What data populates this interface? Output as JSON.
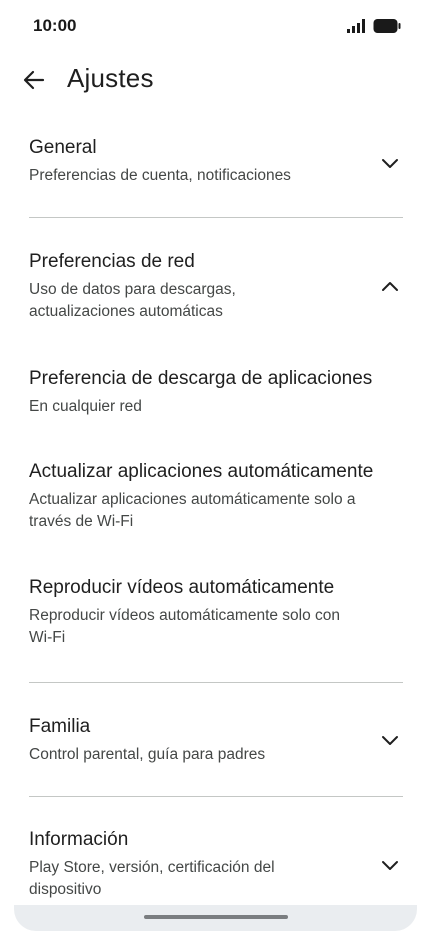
{
  "status": {
    "time": "10:00",
    "icons": [
      "signal-icon",
      "battery-icon"
    ]
  },
  "header": {
    "back_icon": "arrow-left-icon",
    "title": "Ajustes"
  },
  "sections": {
    "general": {
      "title": "General",
      "subtitle": "Preferencias de cuenta, notificaciones",
      "state": "collapsed"
    },
    "network": {
      "title": "Preferencias de red",
      "subtitle_line1": "Uso de datos para descargas,",
      "subtitle_line2": "actualizaciones automáticas",
      "state": "expanded",
      "items": [
        {
          "title": "Preferencia de descarga de aplicaciones",
          "subtitle_line1": "En cualquier red",
          "subtitle_line2": ""
        },
        {
          "title": "Actualizar aplicaciones automáticamente",
          "subtitle_line1": "Actualizar aplicaciones automáticamente solo a",
          "subtitle_line2": "través de Wi-Fi"
        },
        {
          "title": "Reproducir vídeos automáticamente",
          "subtitle_line1": "Reproducir vídeos automáticamente solo con",
          "subtitle_line2": "Wi-Fi"
        }
      ]
    },
    "family": {
      "title": "Familia",
      "subtitle": "Control parental, guía para padres",
      "state": "collapsed"
    },
    "about": {
      "title": "Información",
      "subtitle_line1": "Play Store, versión, certificación del",
      "subtitle_line2": "dispositivo",
      "state": "collapsed"
    }
  }
}
